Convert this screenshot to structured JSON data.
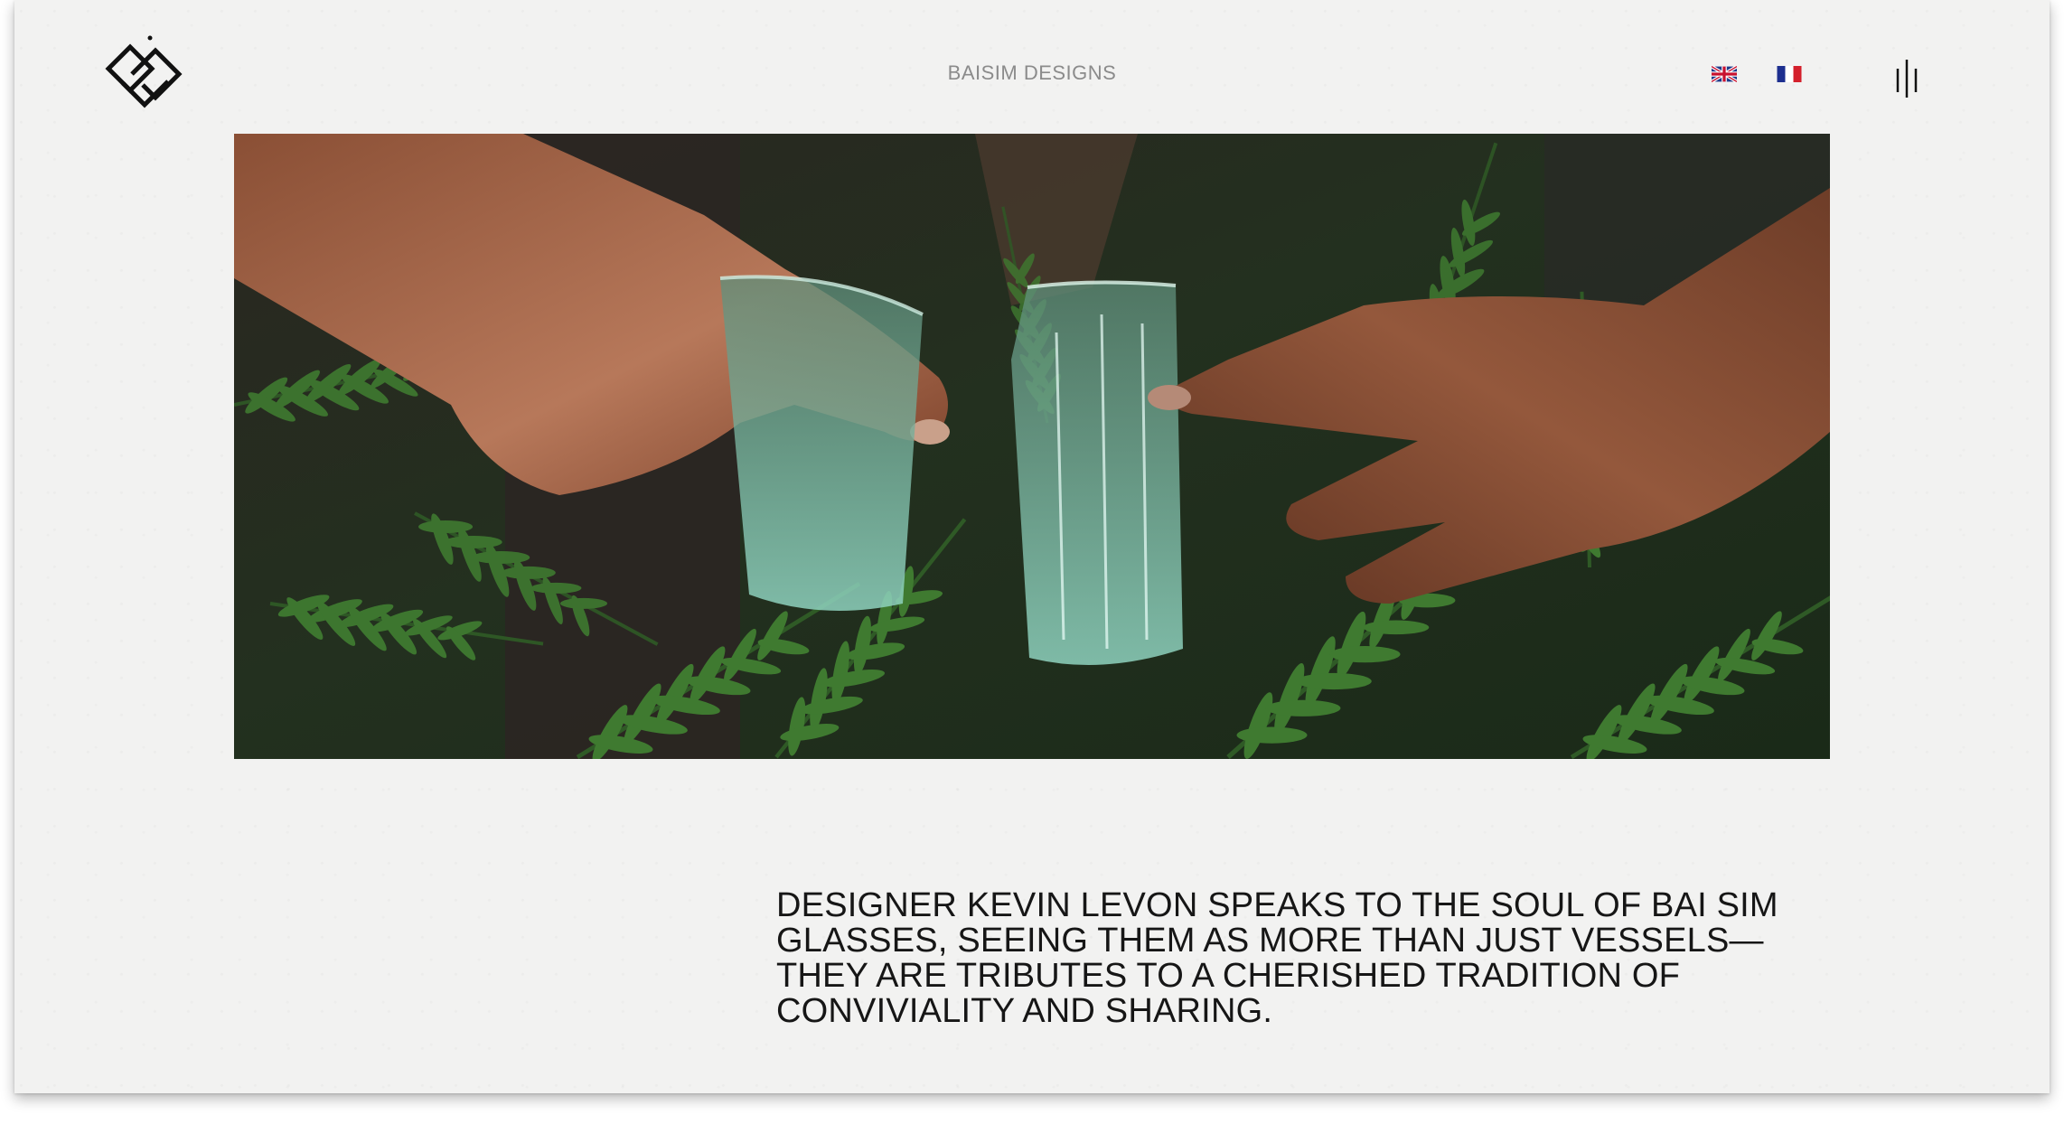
{
  "header": {
    "brand": "BAISIM DESIGNS",
    "logo_icon": "baisim-logo-icon",
    "languages": [
      {
        "code": "en",
        "icon": "uk-flag-icon"
      },
      {
        "code": "fr",
        "icon": "france-flag-icon"
      }
    ],
    "menu_icon": "menu-bars-icon"
  },
  "hero": {
    "image": "hands-toasting-glasses-image"
  },
  "intro": {
    "text": "DESIGNER KEVIN LEVON SPEAKS TO THE SOUL OF BAI SIM GLASSES, SEEING THEM AS MORE THAN JUST VESSELS—THEY ARE TRIBUTES TO A CHERISHED TRADITION OF CONVIVIALITY AND SHARING."
  },
  "colors": {
    "background": "#f2f2f1",
    "text": "#161616",
    "brand_text": "#8b8b8b"
  }
}
